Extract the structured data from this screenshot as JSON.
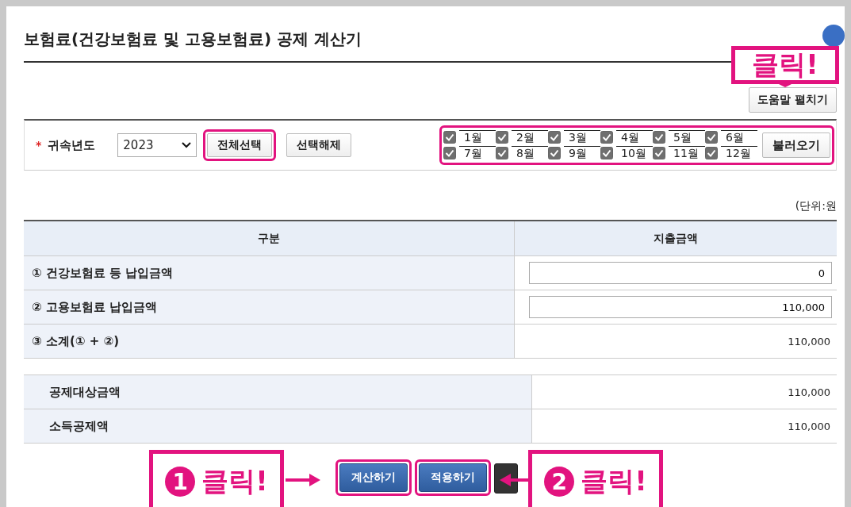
{
  "title": "보험료(건강보험료 및 고용보험료) 공제 계산기",
  "help_button": "도움말 펼치기",
  "filter": {
    "required_mark": "*",
    "label": "귀속년도",
    "year": "2023",
    "buttons": [
      {
        "label": "전체선택",
        "highlighted": true
      },
      {
        "label": "선택해제",
        "highlighted": false
      }
    ],
    "months_highlighted": true,
    "months": [
      {
        "label": "1월",
        "checked": true
      },
      {
        "label": "2월",
        "checked": true
      },
      {
        "label": "3월",
        "checked": true
      },
      {
        "label": "4월",
        "checked": true
      },
      {
        "label": "5월",
        "checked": true
      },
      {
        "label": "6월",
        "checked": true
      },
      {
        "label": "7월",
        "checked": true
      },
      {
        "label": "8월",
        "checked": true
      },
      {
        "label": "9월",
        "checked": true
      },
      {
        "label": "10월",
        "checked": true
      },
      {
        "label": "11월",
        "checked": true
      },
      {
        "label": "12월",
        "checked": true
      }
    ],
    "load_button": "불러오기"
  },
  "unit": "(단위:원",
  "table": {
    "columns": [
      "구분",
      "지출금액"
    ],
    "rows": [
      {
        "label": "① 건강보험료 등 납입금액",
        "kind": "input",
        "value": "0"
      },
      {
        "label": "② 고용보험료 납입금액",
        "kind": "input",
        "value": "110,000"
      },
      {
        "label": "③ 소계(① + ②)",
        "kind": "text",
        "value": "110,000"
      }
    ]
  },
  "summary_rows": [
    {
      "label": "공제대상금액",
      "value": "110,000"
    },
    {
      "label": "소득공제액",
      "value": "110,000"
    }
  ],
  "action_buttons": [
    {
      "label": "계산하기",
      "highlighted": true
    },
    {
      "label": "적용하기",
      "highlighted": true
    }
  ],
  "annotations": [
    {
      "text": "클릭!"
    },
    {
      "number": "1",
      "text": "클릭!"
    },
    {
      "number": "2",
      "text": "클릭!"
    }
  ]
}
